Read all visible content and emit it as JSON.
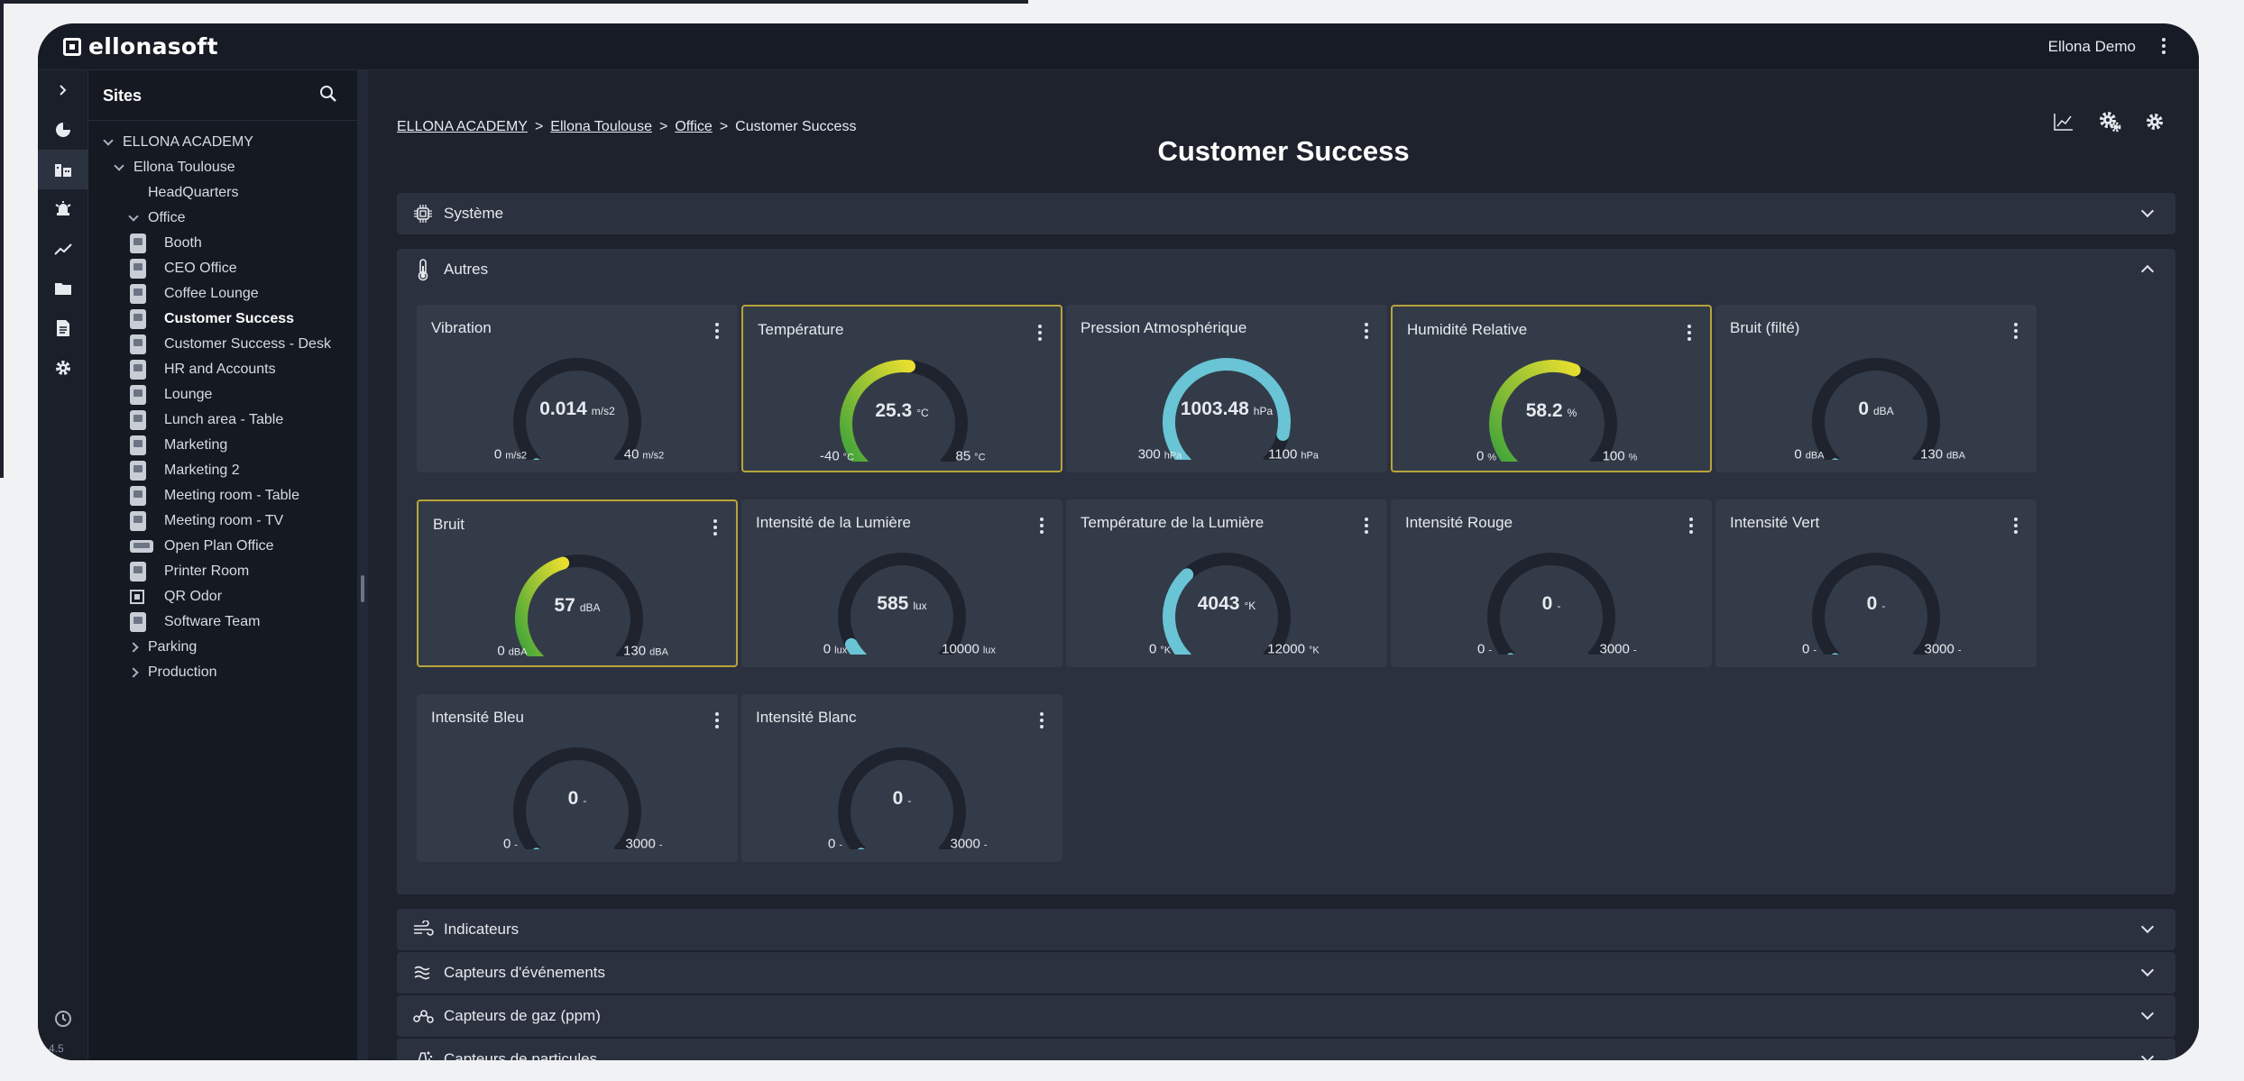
{
  "brand": {
    "name": "ellonasoft"
  },
  "user": {
    "name": "Ellona Demo"
  },
  "app": {
    "version": "4.5"
  },
  "colors": {
    "accent_warn": "#b7a43a",
    "gauge_track": "#1e232d",
    "gauge_cyan": "#69c4d5",
    "gauge_green": "#3aa23a",
    "gauge_yellow": "#e7de2f"
  },
  "rail": {
    "items": [
      "expand-icon",
      "dashboard-icon",
      "sites-icon",
      "alarm-icon",
      "trend-icon",
      "folder-icon",
      "report-icon",
      "settings-icon"
    ],
    "bottom_icon": "clock-icon"
  },
  "sites": {
    "title": "Sites",
    "tree": [
      {
        "label": "ELLONA ACADEMY",
        "level": 0,
        "expander": "down"
      },
      {
        "label": "Ellona Toulouse",
        "level": 1,
        "expander": "down"
      },
      {
        "label": "HeadQuarters",
        "level": 2
      },
      {
        "label": "Office",
        "level": 2,
        "expander": "down"
      },
      {
        "label": "Booth",
        "level": 3,
        "icon": "room"
      },
      {
        "label": "CEO Office",
        "level": 3,
        "icon": "room"
      },
      {
        "label": "Coffee Lounge",
        "level": 3,
        "icon": "room"
      },
      {
        "label": "Customer Success",
        "level": 3,
        "icon": "room",
        "selected": true
      },
      {
        "label": "Customer Success - Desk",
        "level": 3,
        "icon": "room"
      },
      {
        "label": "HR and Accounts",
        "level": 3,
        "icon": "room"
      },
      {
        "label": "Lounge",
        "level": 3,
        "icon": "room"
      },
      {
        "label": "Lunch area - Table",
        "level": 3,
        "icon": "room"
      },
      {
        "label": "Marketing",
        "level": 3,
        "icon": "room"
      },
      {
        "label": "Marketing 2",
        "level": 3,
        "icon": "room"
      },
      {
        "label": "Meeting room - Table",
        "level": 3,
        "icon": "room"
      },
      {
        "label": "Meeting room - TV",
        "level": 3,
        "icon": "room"
      },
      {
        "label": "Open Plan Office",
        "level": 3,
        "icon": "room-wide"
      },
      {
        "label": "Printer Room",
        "level": 3,
        "icon": "room"
      },
      {
        "label": "QR Odor",
        "level": 3,
        "icon": "qr"
      },
      {
        "label": "Software Team",
        "level": 3,
        "icon": "room"
      },
      {
        "label": "Parking",
        "level": 2,
        "expander": "right"
      },
      {
        "label": "Production",
        "level": 2,
        "expander": "right"
      }
    ]
  },
  "breadcrumb": {
    "academy": "ELLONA ACADEMY",
    "toulouse": "Ellona Toulouse",
    "office": "Office",
    "current": "Customer Success",
    "sep": ">"
  },
  "page": {
    "title": "Customer Success"
  },
  "sections": {
    "systeme": "Système",
    "autres": "Autres",
    "indicateurs": "Indicateurs",
    "evenements": "Capteurs d'événements",
    "gaz": "Capteurs de gaz (ppm)",
    "particules": "Capteurs de particules"
  },
  "sensors": [
    {
      "title": "Vibration",
      "value": "0.014",
      "unit": "m/s2",
      "min": "0",
      "max": "40",
      "fraction": 0.0,
      "color": "#69c4d5",
      "warn": false
    },
    {
      "title": "Température",
      "value": "25.3",
      "unit": "°C",
      "min": "-40",
      "max": "85",
      "fraction": 0.52,
      "color": "gradient",
      "warn": true
    },
    {
      "title": "Pression Atmosphérique",
      "value": "1003.48",
      "unit": "hPa",
      "min": "300",
      "max": "1100",
      "fraction": 0.88,
      "color": "#69c4d5",
      "warn": false
    },
    {
      "title": "Humidité Relative",
      "value": "58.2",
      "unit": "%",
      "min": "0",
      "max": "100",
      "fraction": 0.58,
      "color": "gradient",
      "warn": true
    },
    {
      "title": "Bruit (filté)",
      "value": "0",
      "unit": "dBA",
      "min": "0",
      "max": "130",
      "fraction": 0.0,
      "color": "#69c4d5",
      "warn": false
    },
    {
      "title": "Bruit",
      "value": "57",
      "unit": "dBA",
      "min": "0",
      "max": "130",
      "fraction": 0.44,
      "color": "gradient",
      "warn": true
    },
    {
      "title": "Intensité de la Lumière",
      "value": "585",
      "unit": "lux",
      "min": "0",
      "max": "10000",
      "fraction": 0.06,
      "color": "#69c4d5",
      "warn": false
    },
    {
      "title": "Température de la Lumière",
      "value": "4043",
      "unit": "°K",
      "min": "0",
      "max": "12000",
      "fraction": 0.34,
      "color": "#69c4d5",
      "warn": false
    },
    {
      "title": "Intensité Rouge",
      "value": "0",
      "unit": "-",
      "min": "0",
      "max": "3000",
      "fraction": 0.0,
      "color": "#69c4d5",
      "warn": false
    },
    {
      "title": "Intensité Vert",
      "value": "0",
      "unit": "-",
      "min": "0",
      "max": "3000",
      "fraction": 0.0,
      "color": "#69c4d5",
      "warn": false
    },
    {
      "title": "Intensité Bleu",
      "value": "0",
      "unit": "-",
      "min": "0",
      "max": "3000",
      "fraction": 0.0,
      "color": "#69c4d5",
      "warn": false
    },
    {
      "title": "Intensité Blanc",
      "value": "0",
      "unit": "-",
      "min": "0",
      "max": "3000",
      "fraction": 0.0,
      "color": "#69c4d5",
      "warn": false
    }
  ]
}
